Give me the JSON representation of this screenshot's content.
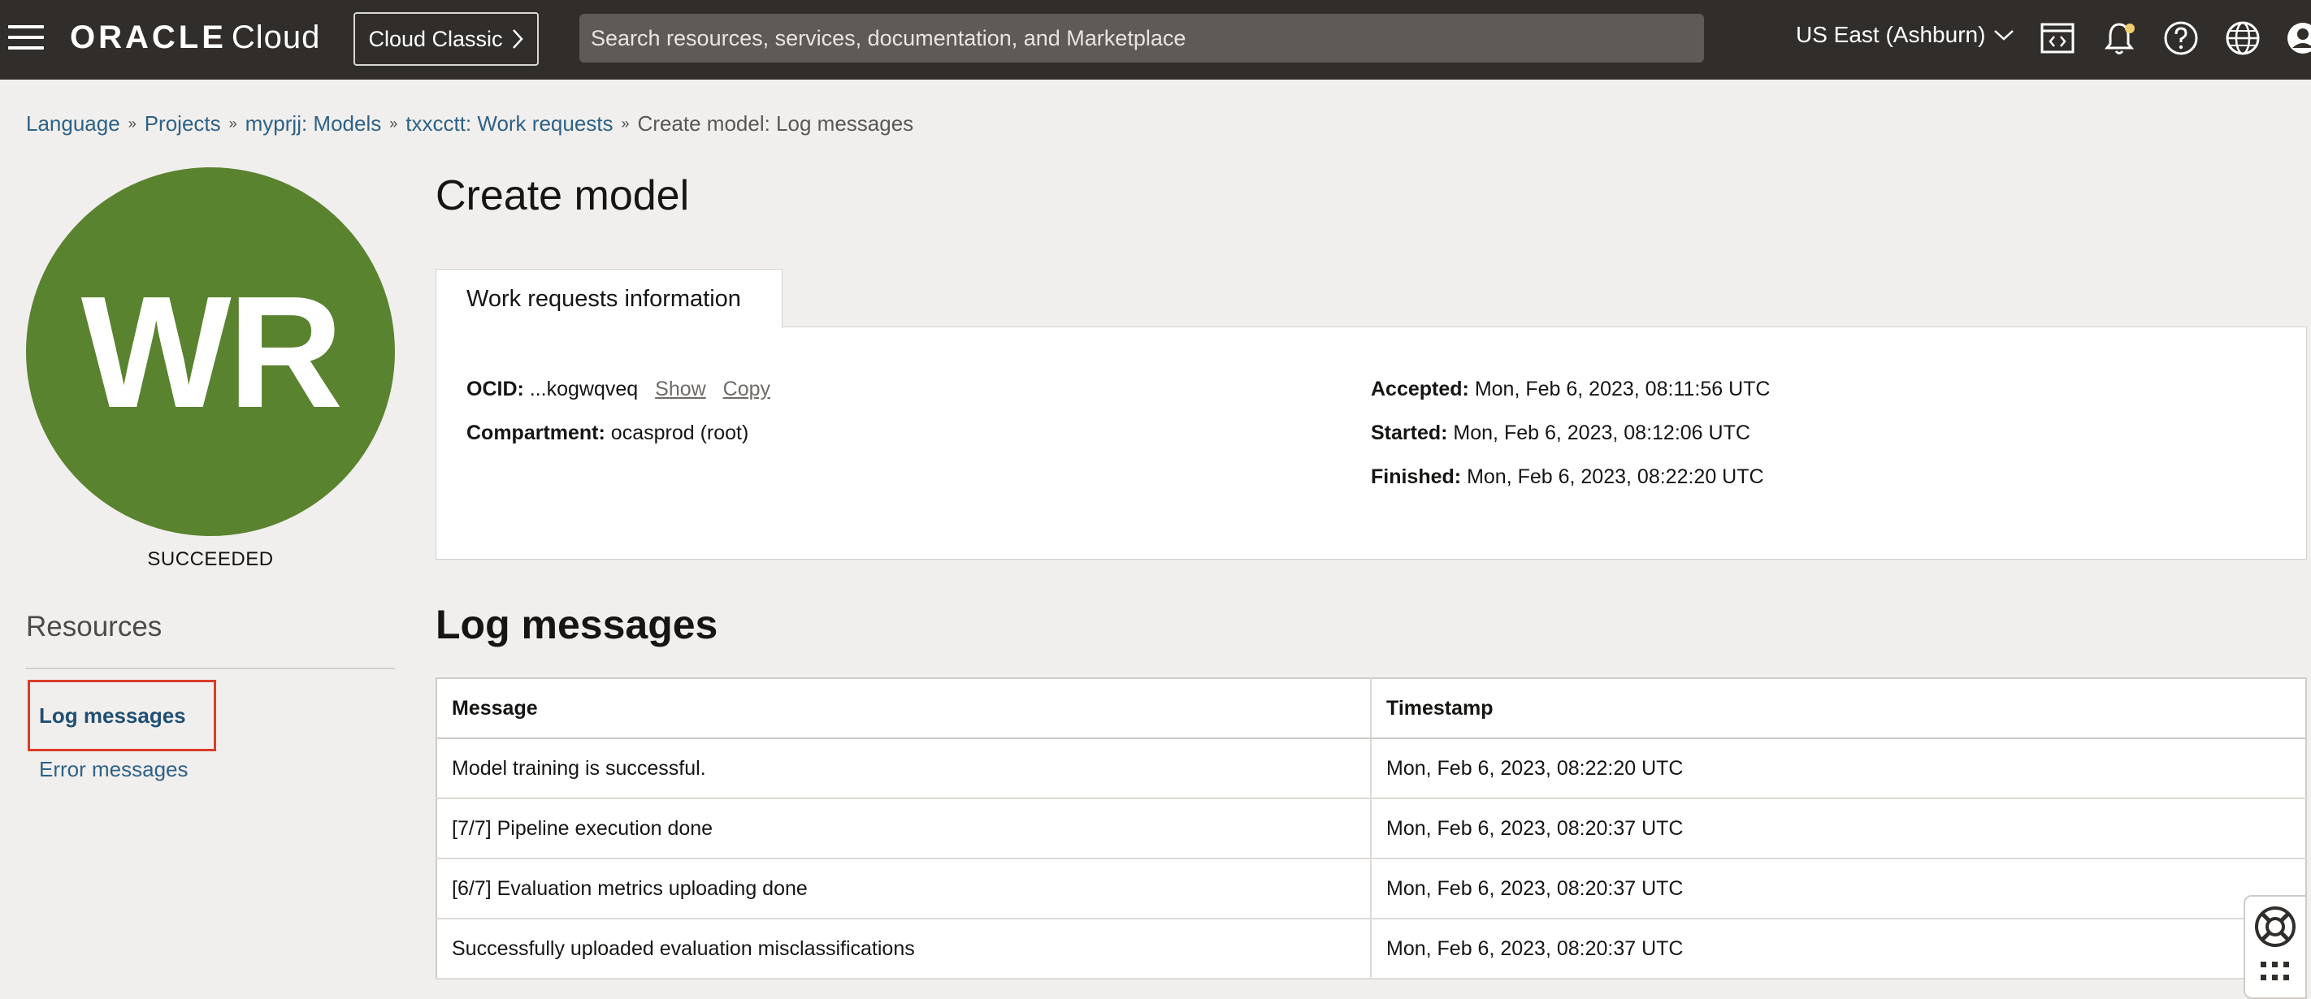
{
  "header": {
    "brand_oracle": "ORACLE",
    "brand_cloud": "Cloud",
    "classic_label": "Cloud Classic",
    "search_placeholder": "Search resources, services, documentation, and Marketplace",
    "region": "US East (Ashburn)"
  },
  "breadcrumb": {
    "items": [
      "Language",
      "Projects",
      "myprjj: Models",
      "txxcctt: Work requests"
    ],
    "current": "Create model: Log messages"
  },
  "avatar": {
    "initials": "WR",
    "status": "SUCCEEDED",
    "color": "#5a8330"
  },
  "resources": {
    "title": "Resources",
    "items": [
      "Log messages",
      "Error messages"
    ],
    "active": "Log messages"
  },
  "page": {
    "title": "Create model",
    "tab_label": "Work requests information"
  },
  "info": {
    "ocid_label": "OCID:",
    "ocid_value": "...kogwqveq",
    "show_label": "Show",
    "copy_label": "Copy",
    "compartment_label": "Compartment:",
    "compartment_value": "ocasprod (root)",
    "accepted_label": "Accepted:",
    "accepted_value": "Mon, Feb 6, 2023, 08:11:56 UTC",
    "started_label": "Started:",
    "started_value": "Mon, Feb 6, 2023, 08:12:06 UTC",
    "finished_label": "Finished:",
    "finished_value": "Mon, Feb 6, 2023, 08:22:20 UTC"
  },
  "log_messages": {
    "title": "Log messages",
    "columns": [
      "Message",
      "Timestamp"
    ],
    "rows": [
      [
        "Model training is successful.",
        "Mon, Feb 6, 2023, 08:22:20 UTC"
      ],
      [
        "[7/7] Pipeline execution done",
        "Mon, Feb 6, 2023, 08:20:37 UTC"
      ],
      [
        "[6/7] Evaluation metrics uploading done",
        "Mon, Feb 6, 2023, 08:20:37 UTC"
      ],
      [
        "Successfully uploaded evaluation misclassifications",
        "Mon, Feb 6, 2023, 08:20:37 UTC"
      ]
    ]
  }
}
